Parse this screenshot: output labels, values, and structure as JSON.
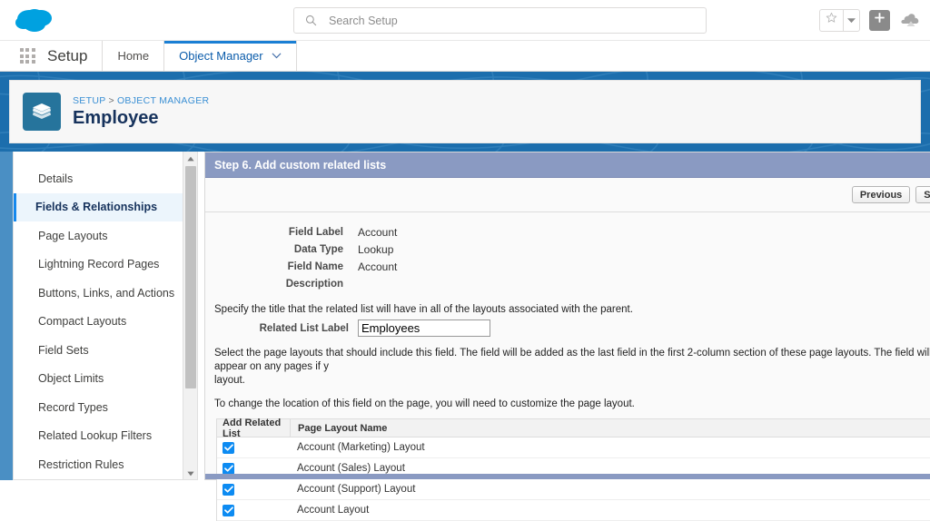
{
  "colors": {
    "brand_blue": "#1c6ead",
    "accent_blue": "#1589ee",
    "step_header": "#8a9ac2",
    "checkbox": "#0d8bf2",
    "breadcrumb_link": "#3a8fd4"
  },
  "global_header": {
    "logo": "salesforce-cloud-logo",
    "search": {
      "placeholder": "Search Setup",
      "value": "",
      "icon": "search-icon"
    },
    "actions": [
      {
        "name": "favorite-star",
        "icon": "star-icon"
      },
      {
        "name": "favorite-dropdown",
        "icon": "chevron-down-icon"
      },
      {
        "name": "add-button",
        "icon": "plus-icon"
      },
      {
        "name": "user-avatar",
        "icon": "avatar-icon"
      }
    ]
  },
  "setup_nav": {
    "app_launcher_icon": "waffle-grid-icon",
    "app_name": "Setup",
    "tabs": [
      {
        "label": "Home",
        "active": false,
        "has_caret": false
      },
      {
        "label": "Object Manager",
        "active": true,
        "has_caret": true
      }
    ]
  },
  "page_header": {
    "object_icon": "layers-stack-icon",
    "breadcrumb": {
      "root": "SETUP",
      "separator": ">",
      "current": "OBJECT MANAGER"
    },
    "title": "Employee"
  },
  "sidebar": {
    "items": [
      {
        "label": "Details",
        "active": false
      },
      {
        "label": "Fields & Relationships",
        "active": true
      },
      {
        "label": "Page Layouts",
        "active": false
      },
      {
        "label": "Lightning Record Pages",
        "active": false
      },
      {
        "label": "Buttons, Links, and Actions",
        "active": false
      },
      {
        "label": "Compact Layouts",
        "active": false
      },
      {
        "label": "Field Sets",
        "active": false
      },
      {
        "label": "Object Limits",
        "active": false
      },
      {
        "label": "Record Types",
        "active": false
      },
      {
        "label": "Related Lookup Filters",
        "active": false
      },
      {
        "label": "Restriction Rules",
        "active": false
      }
    ],
    "scrollbar": {
      "up_arrow": "scroll-up-arrow-icon",
      "down_arrow": "scroll-down-arrow-icon"
    }
  },
  "main": {
    "step_title": "Step 6. Add custom related lists",
    "buttons": [
      {
        "label": "Previous"
      },
      {
        "label": "Save & N"
      }
    ],
    "field_summary": [
      {
        "label": "Field Label",
        "value": "Account"
      },
      {
        "label": "Data Type",
        "value": "Lookup"
      },
      {
        "label": "Field Name",
        "value": "Account"
      },
      {
        "label": "Description",
        "value": ""
      }
    ],
    "related_list_intro": "Specify the title that the related list will have in all of the layouts associated with the parent.",
    "related_list_label": "Related List Label",
    "related_list_value": "Employees",
    "paragraph_1": "Select the page layouts that should include this field. The field will be added as the last field in the first 2-column section of these page layouts. The field will not appear on any pages if y",
    "paragraph_1_cont": "layout.",
    "paragraph_2": "To change the location of this field on the page, you will need to customize the page layout.",
    "table": {
      "columns": [
        "Add Related List",
        "Page Layout Name"
      ],
      "rows": [
        {
          "checked": true,
          "layout": "Account (Marketing) Layout"
        },
        {
          "checked": true,
          "layout": "Account (Sales) Layout"
        },
        {
          "checked": true,
          "layout": "Account (Support) Layout"
        },
        {
          "checked": true,
          "layout": "Account Layout"
        }
      ]
    }
  }
}
